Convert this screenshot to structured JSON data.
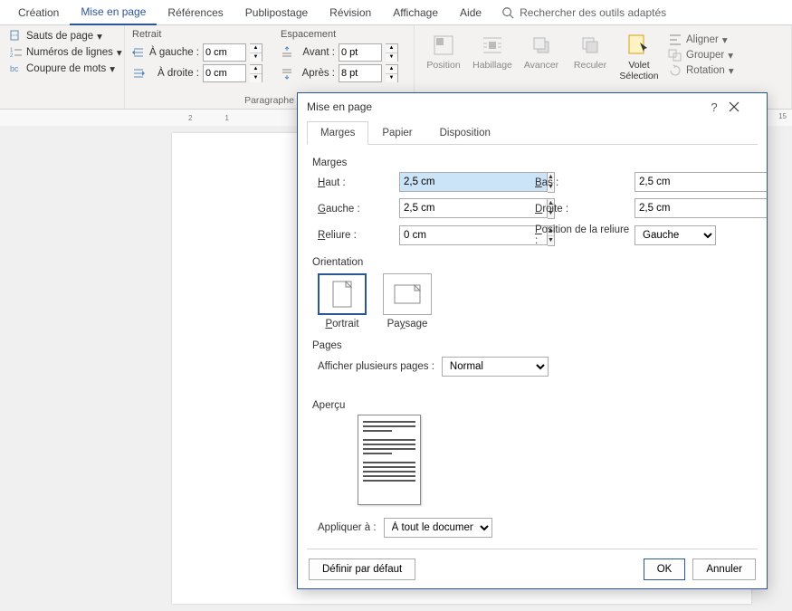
{
  "ribbon": {
    "tabs": [
      "Création",
      "Mise en page",
      "Références",
      "Publipostage",
      "Révision",
      "Affichage",
      "Aide"
    ],
    "active_tab_index": 1,
    "search_placeholder": "Rechercher des outils adaptés"
  },
  "page_setup_group": {
    "page_breaks": "Sauts de page",
    "line_numbers": "Numéros de lignes",
    "hyphenation": "Coupure de mots",
    "title": "Paragraphe"
  },
  "indent": {
    "header": "Retrait",
    "left_label": "À gauche :",
    "left_value": "0 cm",
    "right_label": "À droite :",
    "right_value": "0 cm"
  },
  "spacing": {
    "header": "Espacement",
    "before_label": "Avant :",
    "before_value": "0 pt",
    "after_label": "Après :",
    "after_value": "8 pt"
  },
  "arrange": {
    "position": "Position",
    "wrap": "Habillage",
    "forward": "Avancer",
    "backward": "Reculer",
    "selection_pane": "Volet Sélection",
    "align": "Aligner",
    "group": "Grouper",
    "rotate": "Rotation"
  },
  "dialog": {
    "title": "Mise en page",
    "tabs": [
      "Marges",
      "Papier",
      "Disposition"
    ],
    "active_tab_index": 0,
    "margins": {
      "section": "Marges",
      "top_label": "Haut :",
      "top_value": "2,5 cm",
      "bottom_label": "Bas :",
      "bottom_value": "2,5 cm",
      "left_label": "Gauche :",
      "left_value": "2,5 cm",
      "right_label": "Droite :",
      "right_value": "2,5 cm",
      "gutter_label": "Reliure :",
      "gutter_value": "0 cm",
      "gutter_pos_label": "Position de la reliure :",
      "gutter_pos_value": "Gauche"
    },
    "orientation": {
      "section": "Orientation",
      "portrait": "Portrait",
      "landscape": "Paysage",
      "selected": "portrait"
    },
    "pages": {
      "section": "Pages",
      "multi_label": "Afficher plusieurs pages :",
      "multi_value": "Normal"
    },
    "preview": {
      "section": "Aperçu"
    },
    "apply": {
      "label": "Appliquer à :",
      "value": "À tout le document"
    },
    "footer": {
      "default": "Définir par défaut",
      "ok": "OK",
      "cancel": "Annuler"
    }
  },
  "ruler_marker": "15"
}
